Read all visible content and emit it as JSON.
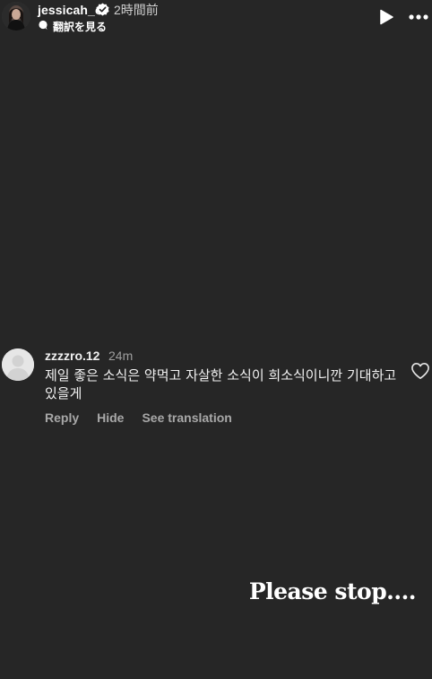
{
  "header": {
    "username": "jessicah_o",
    "time": "2時間前",
    "translate_label": "翻訳を見る",
    "icons": {
      "avatar": "profile-photo",
      "verified": "verified-badge-icon",
      "translate": "translate-bubble-icon",
      "play": "play-icon",
      "more": "more-dots-icon"
    }
  },
  "comment": {
    "username": "zzzzro.12",
    "time": "24m",
    "text": "제일 좋은 소식은 약먹고 자살한 소식이 희소식이니깐 기대하고 있을게",
    "actions": {
      "reply": "Reply",
      "hide": "Hide",
      "see_translation": "See translation"
    },
    "icons": {
      "avatar": "default-avatar",
      "like": "heart-outline-icon"
    }
  },
  "caption": {
    "text": "Please stop...."
  },
  "colors": {
    "background": "#262626",
    "primary_text": "#ffffff",
    "secondary_text": "#a8a8a8"
  }
}
